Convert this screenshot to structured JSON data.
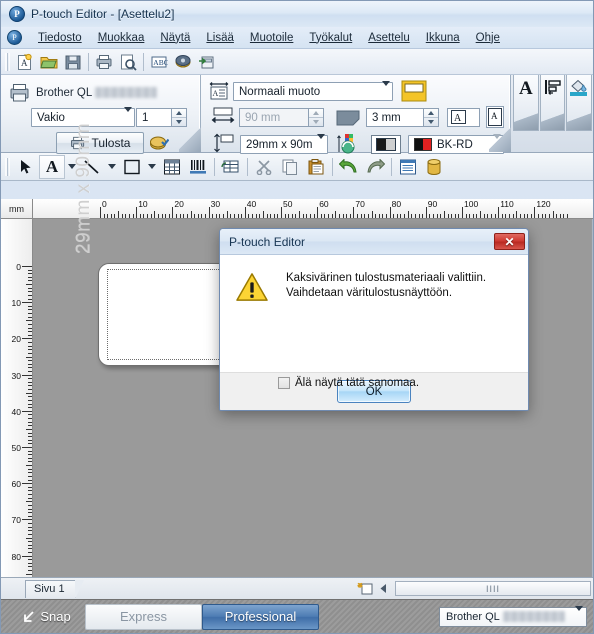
{
  "window": {
    "title": "P-touch Editor - [Asettelu2]",
    "app_icon": "ptouch-logo-icon"
  },
  "menubar": {
    "items": [
      {
        "label": "Tiedosto",
        "acc": "T"
      },
      {
        "label": "Muokkaa",
        "acc": "M"
      },
      {
        "label": "Näytä",
        "acc": "N"
      },
      {
        "label": "Lisää",
        "acc": "L"
      },
      {
        "label": "Muotoile",
        "acc": "u"
      },
      {
        "label": "Työkalut",
        "acc": "y"
      },
      {
        "label": "Asettelu",
        "acc": "A"
      },
      {
        "label": "Ikkuna",
        "acc": "I"
      },
      {
        "label": "Ohje",
        "acc": "O"
      }
    ]
  },
  "toolbar_standard": {
    "buttons": [
      {
        "name": "new-layout-icon",
        "glyph": "new"
      },
      {
        "name": "open-folder-icon",
        "glyph": "open"
      },
      {
        "name": "save-icon",
        "glyph": "save"
      },
      {
        "name": "print-icon",
        "glyph": "print"
      },
      {
        "name": "print-preview-icon",
        "glyph": "preview"
      },
      {
        "name": "spell-check-icon",
        "glyph": "abc"
      },
      {
        "name": "print-options-icon",
        "glyph": "printopts"
      },
      {
        "name": "export-icon",
        "glyph": "export"
      }
    ]
  },
  "print_panel": {
    "printer_label": "Brother QL",
    "printer_model_redacted": true,
    "quality_value": "Vakio",
    "copies_value": "1",
    "print_button_label": "Tulosta",
    "print_icon": "printer-icon",
    "options_icon": "print-options-icon"
  },
  "format_panel": {
    "layout_style_value": "Normaali muoto",
    "layout_style_icon": "layout-style-icon",
    "orientation_icon": "label-orientation-icon",
    "length_value": "90 mm",
    "length_icon": "label-length-icon",
    "margin_value": "3 mm",
    "margin_icon": "label-margin-icon",
    "tape_size_value": "29mm x 90m",
    "tape_size_icon": "tape-height-icon",
    "rotate_icon": "rotate-colors-icon",
    "contrast_icon": "bw-contrast-icon",
    "color_value": "BK-RD",
    "color_swatch_left": "#111111",
    "color_swatch_right": "#e42121",
    "text_fit_icon": "text-fit-icon",
    "text_frame_icon": "text-frame-icon"
  },
  "side_tabs": [
    {
      "name": "tab-text-properties",
      "icon": "letter-a-icon"
    },
    {
      "name": "tab-layout-properties",
      "icon": "align-left-icon"
    },
    {
      "name": "tab-background-properties",
      "icon": "paint-bucket-icon"
    }
  ],
  "toolbar_draw": {
    "buttons": [
      {
        "name": "select-tool",
        "icon": "cursor-arrow-icon"
      },
      {
        "name": "text-tool",
        "icon": "letter-a-icon"
      },
      {
        "name": "text-tool-dropdown",
        "icon": "chevron-down-icon"
      },
      {
        "name": "line-tool",
        "icon": "line-icon"
      },
      {
        "name": "line-tool-dropdown",
        "icon": "chevron-down-icon"
      },
      {
        "name": "rectangle-tool",
        "icon": "rectangle-icon"
      },
      {
        "name": "rectangle-tool-dropdown",
        "icon": "chevron-down-icon"
      },
      {
        "name": "table-tool",
        "icon": "table-icon"
      },
      {
        "name": "barcode-tool",
        "icon": "barcode-icon"
      },
      {
        "name": "database-connect-tool",
        "icon": "db-link-icon"
      },
      {
        "name": "cut-button",
        "icon": "scissors-icon"
      },
      {
        "name": "copy-button",
        "icon": "copy-icon"
      },
      {
        "name": "paste-button",
        "icon": "clipboard-icon"
      },
      {
        "name": "undo-button",
        "icon": "undo-arrow-icon"
      },
      {
        "name": "redo-button",
        "icon": "redo-arrow-icon"
      },
      {
        "name": "properties-button",
        "icon": "properties-list-icon"
      },
      {
        "name": "database-button",
        "icon": "database-cylinder-icon"
      }
    ]
  },
  "rulers": {
    "unit": "mm",
    "horizontal_labels": [
      "0",
      "10",
      "20",
      "30",
      "40",
      "50",
      "60",
      "70",
      "80",
      "90",
      "100",
      "110",
      "120"
    ],
    "vertical_labels": [
      "0",
      "10",
      "20",
      "30",
      "40",
      "50",
      "60",
      "70",
      "80"
    ]
  },
  "canvas": {
    "label_size_text": "29mm x 90mm"
  },
  "dialog": {
    "title": "P-touch Editor",
    "close_label": "✕",
    "icon": "warning-triangle-icon",
    "message_line1": "Kaksivärinen tulostusmateriaali valittiin.",
    "message_line2": "Vaihdetaan väritulostusnäyttöön.",
    "checkbox_label": "Älä näytä tätä sanomaa.",
    "checkbox_checked": false,
    "ok_label": "OK"
  },
  "pagebar": {
    "page_tab_label": "Sivu 1",
    "add_page_icon": "add-page-icon",
    "scroll_left_icon": "scroll-left-icon",
    "scroll_thumb_grip": "IIII"
  },
  "modebar": {
    "snap_label": "Snap",
    "snap_icon": "snap-arrow-icon",
    "express_label": "Express",
    "professional_label": "Professional",
    "active_mode": "Professional",
    "printer_label": "Brother QL",
    "printer_model_redacted": true
  },
  "colors": {
    "accent_blue": "#4d7cb3",
    "workspace_gray": "#9a9a9a",
    "warning_yellow": "#ffcc00",
    "close_red": "#cf3b33"
  }
}
